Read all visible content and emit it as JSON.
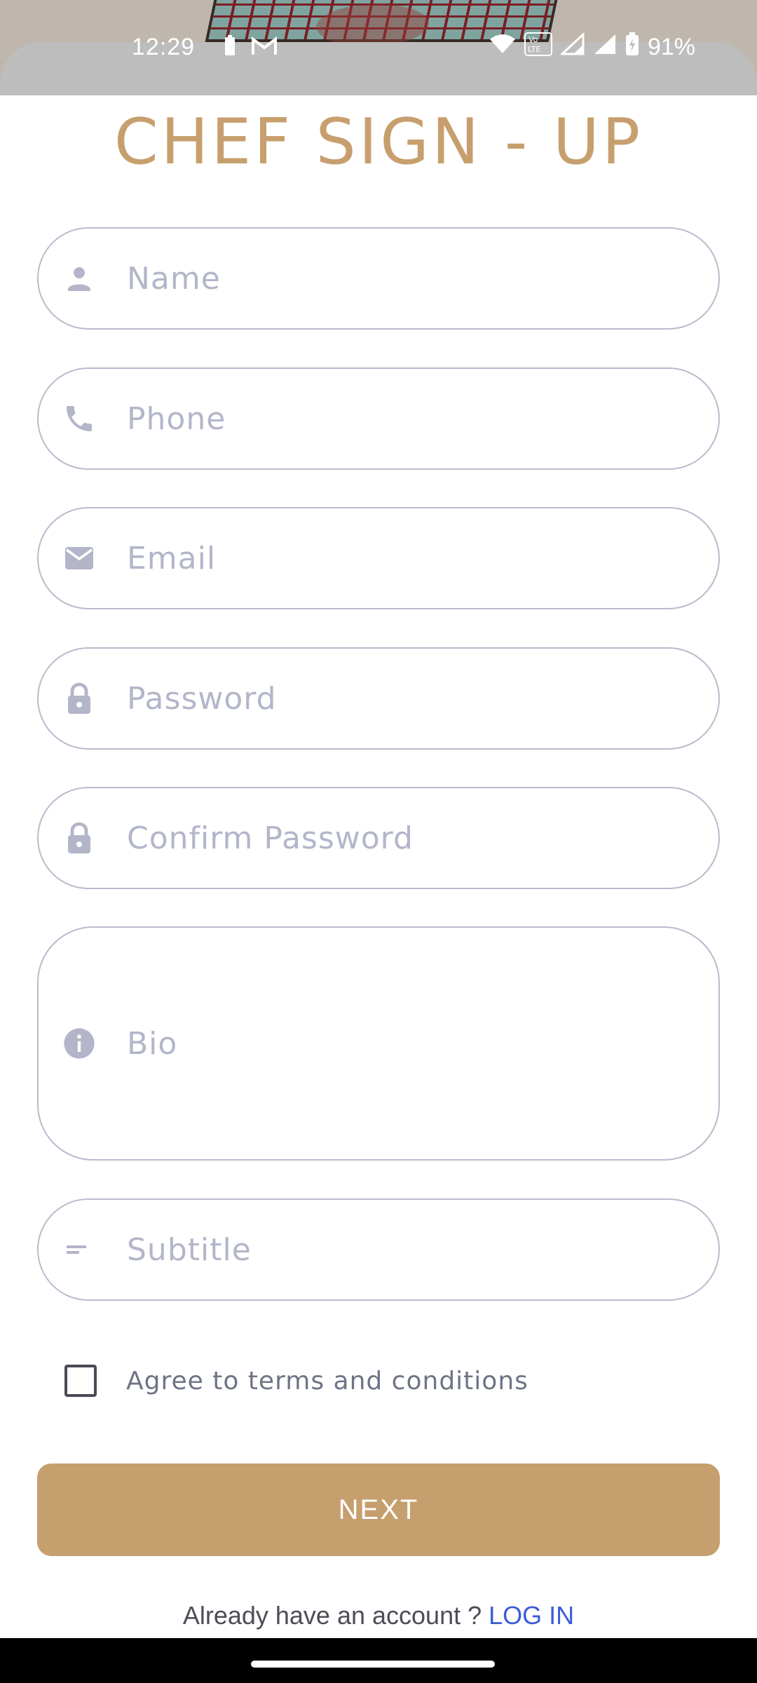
{
  "status_bar": {
    "time": "12:29",
    "battery_percent": "91%",
    "icons": [
      "battery-small-icon",
      "gmail-icon",
      "wifi-icon",
      "volte-icon",
      "signal-1-icon",
      "signal-2-icon",
      "battery-charging-icon"
    ]
  },
  "header": {
    "title": "CHEF SIGN - UP"
  },
  "form": {
    "name": {
      "placeholder": "Name",
      "icon": "person-icon"
    },
    "phone": {
      "placeholder": "Phone",
      "icon": "phone-icon"
    },
    "email": {
      "placeholder": "Email",
      "icon": "mail-icon"
    },
    "password": {
      "placeholder": "Password",
      "icon": "lock-icon"
    },
    "confirm_password": {
      "placeholder": "Confirm Password",
      "icon": "lock-icon"
    },
    "bio": {
      "placeholder": "Bio",
      "icon": "info-icon"
    },
    "subtitle": {
      "placeholder": "Subtitle",
      "icon": "short-text-icon"
    },
    "terms_label": "Agree to terms and conditions",
    "terms_checked": false,
    "next_label": "NEXT"
  },
  "footer": {
    "prompt": "Already have an account ?",
    "login_label": "LOG IN"
  },
  "colors": {
    "title": "#c79f6e",
    "button": "#c59f6d",
    "field_border": "#b9bbcc",
    "icon": "#b3b6c9",
    "link": "#3d5bd9"
  }
}
